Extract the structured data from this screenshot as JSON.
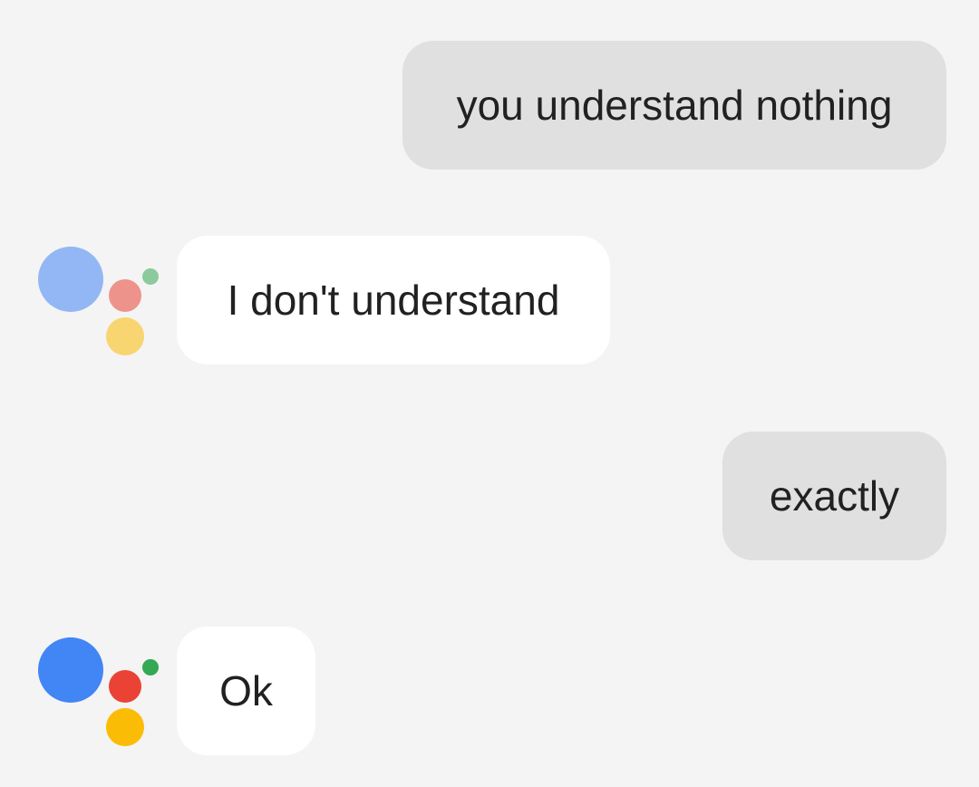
{
  "conversation": {
    "messages": [
      {
        "role": "user",
        "text": "you understand nothing"
      },
      {
        "role": "assistant",
        "text": "I don't understand"
      },
      {
        "role": "user",
        "text": "exactly"
      },
      {
        "role": "assistant",
        "text": "Ok"
      }
    ]
  },
  "assistant_avatar": {
    "icon": "google-assistant-icon",
    "colors": {
      "blue": "#4285f4",
      "red": "#ea4335",
      "yellow": "#fbbc05",
      "green": "#34a853"
    },
    "faded_first_avatar": true
  },
  "theme": {
    "background": "#f4f4f4",
    "user_bubble": "#e0e0e0",
    "assistant_bubble": "#ffffff",
    "text": "#212121"
  }
}
